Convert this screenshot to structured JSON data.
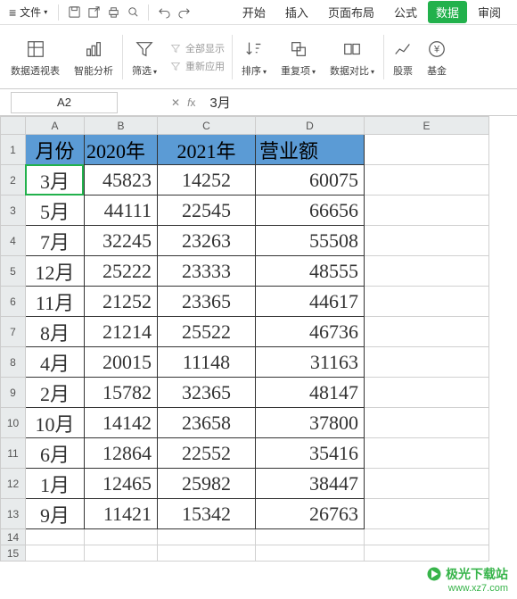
{
  "menubar": {
    "file_label": "文件",
    "tabs": [
      "开始",
      "插入",
      "页面布局",
      "公式",
      "数据",
      "审阅"
    ],
    "active_tab_index": 4
  },
  "ribbon": {
    "pivot": "数据透视表",
    "smart": "智能分析",
    "filter": "筛选",
    "show_all": "全部显示",
    "reapply": "重新应用",
    "sort": "排序",
    "dedup": "重复项",
    "compare": "数据对比",
    "stock": "股票",
    "fund": "基金"
  },
  "refbar": {
    "cell_ref": "A2",
    "formula_value": "3月"
  },
  "columns": [
    "A",
    "B",
    "C",
    "D",
    "E"
  ],
  "header_row": [
    "月份",
    "2020年",
    "2021年",
    "营业额"
  ],
  "chart_data": {
    "type": "table",
    "columns": [
      "月份",
      "2020年",
      "2021年",
      "营业额"
    ],
    "rows": [
      {
        "month": "3月",
        "y2020": 45823,
        "y2021": 14252,
        "total": 60075
      },
      {
        "month": "5月",
        "y2020": 44111,
        "y2021": 22545,
        "total": 66656
      },
      {
        "month": "7月",
        "y2020": 32245,
        "y2021": 23263,
        "total": 55508
      },
      {
        "month": "12月",
        "y2020": 25222,
        "y2021": 23333,
        "total": 48555
      },
      {
        "month": "11月",
        "y2020": 21252,
        "y2021": 23365,
        "total": 44617
      },
      {
        "month": "8月",
        "y2020": 21214,
        "y2021": 25522,
        "total": 46736
      },
      {
        "month": "4月",
        "y2020": 20015,
        "y2021": 11148,
        "total": 31163
      },
      {
        "month": "2月",
        "y2020": 15782,
        "y2021": 32365,
        "total": 48147
      },
      {
        "month": "10月",
        "y2020": 14142,
        "y2021": 23658,
        "total": 37800
      },
      {
        "month": "6月",
        "y2020": 12864,
        "y2021": 22552,
        "total": 35416
      },
      {
        "month": "1月",
        "y2020": 12465,
        "y2021": 25982,
        "total": 38447
      },
      {
        "month": "9月",
        "y2020": 11421,
        "y2021": 15342,
        "total": 26763
      }
    ]
  },
  "watermark": {
    "name": "极光下载站",
    "url": "www.xz7.com"
  }
}
